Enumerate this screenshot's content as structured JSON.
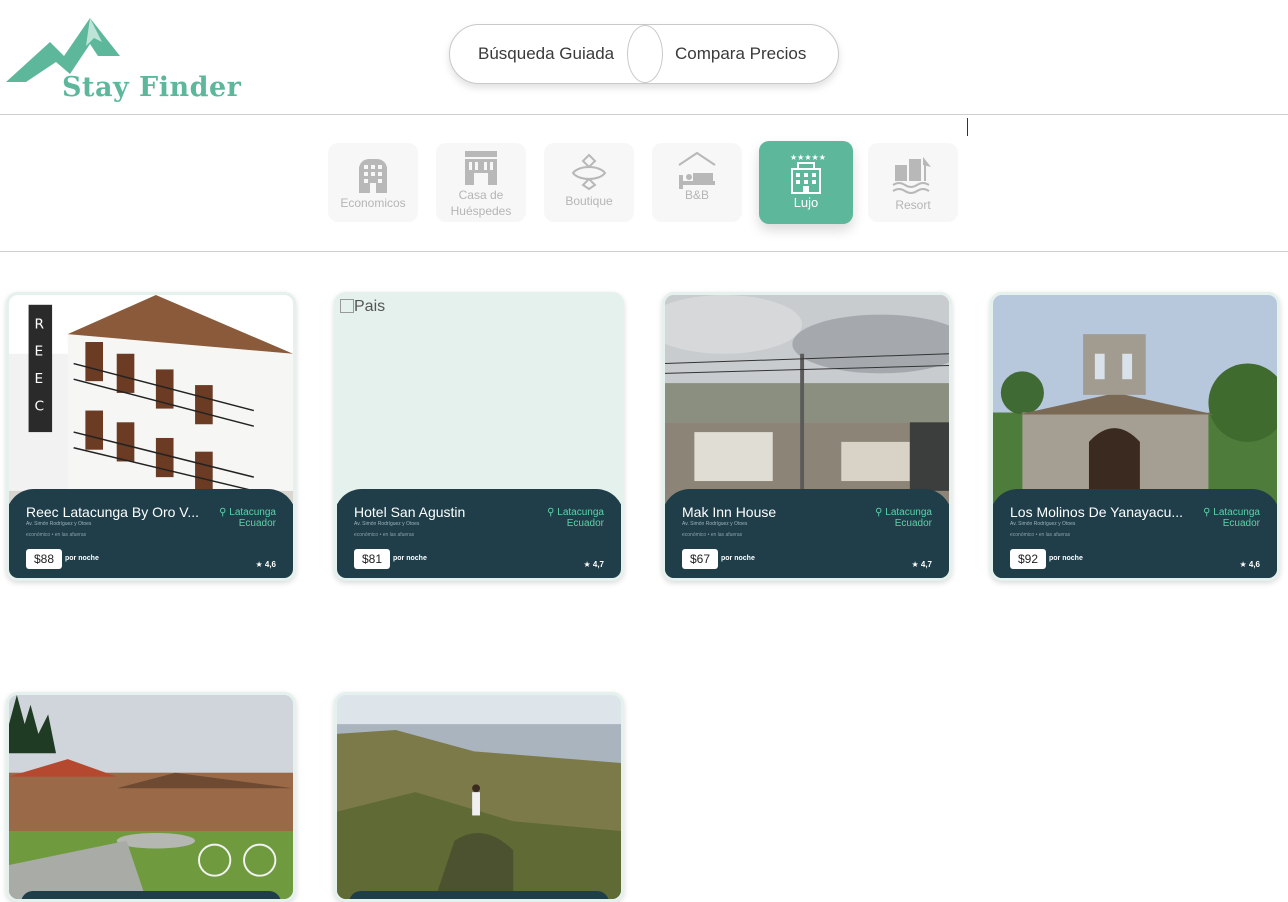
{
  "brand": {
    "name": "Stay Finder",
    "color": "#5db89b"
  },
  "search_mode": {
    "guided_label": "Búsqueda Guiada",
    "compare_label": "Compara Precios"
  },
  "categories": [
    {
      "label": "Economicos",
      "icon": "building-icon",
      "active": false
    },
    {
      "label": "Casa de Huéspedes",
      "icon": "guesthouse-icon",
      "active": false
    },
    {
      "label": "Boutique",
      "icon": "ornament-icon",
      "active": false
    },
    {
      "label": "B&B",
      "icon": "bed-icon",
      "active": false
    },
    {
      "label": "Lujo",
      "icon": "luxury-hotel-icon",
      "active": true
    },
    {
      "label": "Resort",
      "icon": "resort-icon",
      "active": false
    }
  ],
  "hotels": [
    {
      "name": "Reec Latacunga By Oro V...",
      "city": "Latacunga",
      "country": "Ecuador",
      "address": "Av. Simón Rodríguez y Otoes",
      "tag": "económico • en las afueras",
      "price": "$88",
      "per_night": "por noche",
      "rating": "★ 4,6"
    },
    {
      "name": "Hotel San Agustin",
      "city": "Latacunga",
      "country": "Ecuador",
      "address": "Av. Simón Rodríguez y Otoes",
      "tag": "económico • en las afueras",
      "price": "$81",
      "per_night": "por noche",
      "rating": "★ 4,7",
      "image_alt": "Pais"
    },
    {
      "name": "Mak Inn House",
      "city": "Latacunga",
      "country": "Ecuador",
      "address": "Av. Simón Rodríguez y Otoes",
      "tag": "económico • en las afueras",
      "price": "$67",
      "per_night": "por noche",
      "rating": "★ 4,7"
    },
    {
      "name": "Los Molinos De Yanayacu...",
      "city": "Latacunga",
      "country": "Ecuador",
      "address": "Av. Simón Rodríguez y Otoes",
      "tag": "económico • en las afueras",
      "price": "$92",
      "per_night": "por noche",
      "rating": "★ 4,6"
    }
  ],
  "colors": {
    "accent": "#5db89b",
    "card_info_bg": "#1f3e49",
    "location_text": "#5dd2a8",
    "card_bg": "#e4f1ec"
  }
}
